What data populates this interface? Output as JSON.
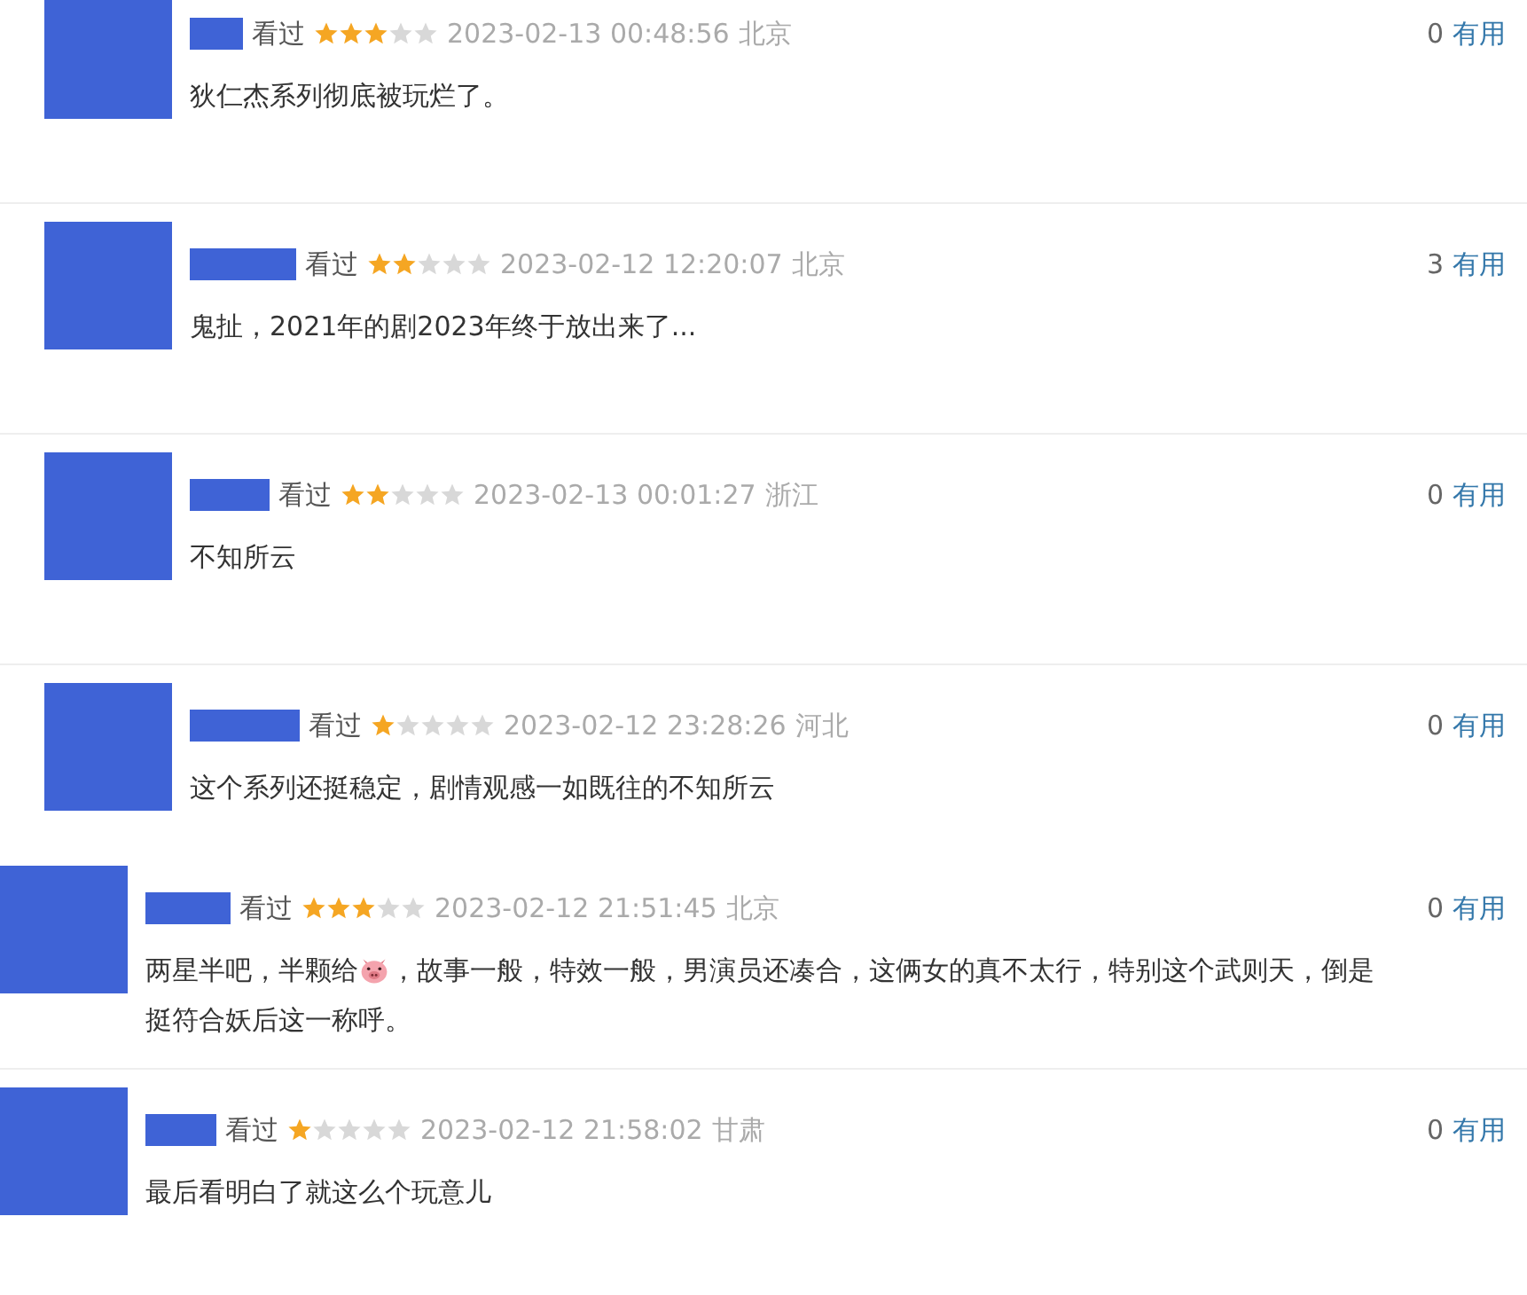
{
  "reviews": [
    {
      "status": "看过",
      "stars": 3,
      "time": "2023-02-13 00:48:56",
      "location": "北京",
      "votes": "0",
      "useful": "有用",
      "comment": [
        {
          "kind": "text",
          "text": "狄仁杰系列彻底被玩烂了。"
        }
      ]
    },
    {
      "status": "看过",
      "stars": 2,
      "time": "2023-02-12 12:20:07",
      "location": "北京",
      "votes": "3",
      "useful": "有用",
      "comment": [
        {
          "kind": "text",
          "text": "鬼扯，2021年的剧2023年终于放出来了..."
        }
      ]
    },
    {
      "status": "看过",
      "stars": 2,
      "time": "2023-02-13 00:01:27",
      "location": "浙江",
      "votes": "0",
      "useful": "有用",
      "comment": [
        {
          "kind": "text",
          "text": "不知所云"
        }
      ]
    },
    {
      "status": "看过",
      "stars": 1,
      "time": "2023-02-12 23:28:26",
      "location": "河北",
      "votes": "0",
      "useful": "有用",
      "comment": [
        {
          "kind": "text",
          "text": "这个系列还挺稳定，剧情观感一如既往的不知所云"
        }
      ]
    },
    {
      "status": "看过",
      "stars": 3,
      "time": "2023-02-12 21:51:45",
      "location": "北京",
      "votes": "0",
      "useful": "有用",
      "comment": [
        {
          "kind": "text",
          "text": "两星半吧，半颗给"
        },
        {
          "kind": "pig"
        },
        {
          "kind": "text",
          "text": "，故事一般，特效一般，男演员还凑合，这俩女的真不太行，特别这个武则天，倒是"
        },
        {
          "kind": "break"
        },
        {
          "kind": "text",
          "text": "挺符合妖后这一称呼。"
        }
      ]
    },
    {
      "status": "看过",
      "stars": 1,
      "time": "2023-02-12 21:58:02",
      "location": "甘肃",
      "votes": "0",
      "useful": "有用",
      "comment": [
        {
          "kind": "text",
          "text": "最后看明白了就这么个玩意儿"
        }
      ]
    }
  ]
}
